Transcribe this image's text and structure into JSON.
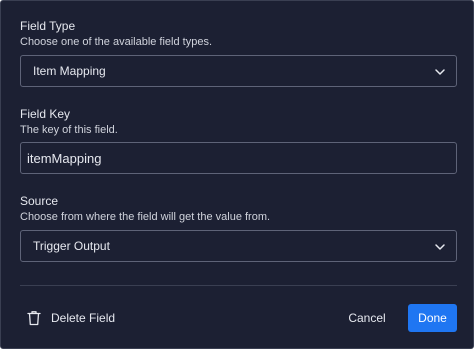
{
  "field_type": {
    "label": "Field Type",
    "description": "Choose one of the available field types.",
    "selected": "Item Mapping"
  },
  "field_key": {
    "label": "Field Key",
    "description": "The key of this field.",
    "value": "itemMapping"
  },
  "source": {
    "label": "Source",
    "description": "Choose from where the field will get the value from.",
    "selected": "Trigger Output"
  },
  "footer": {
    "delete_label": "Delete Field",
    "cancel_label": "Cancel",
    "done_label": "Done"
  },
  "colors": {
    "background": "#1c2033",
    "primary": "#1f76f2",
    "border": "#5e6378"
  }
}
